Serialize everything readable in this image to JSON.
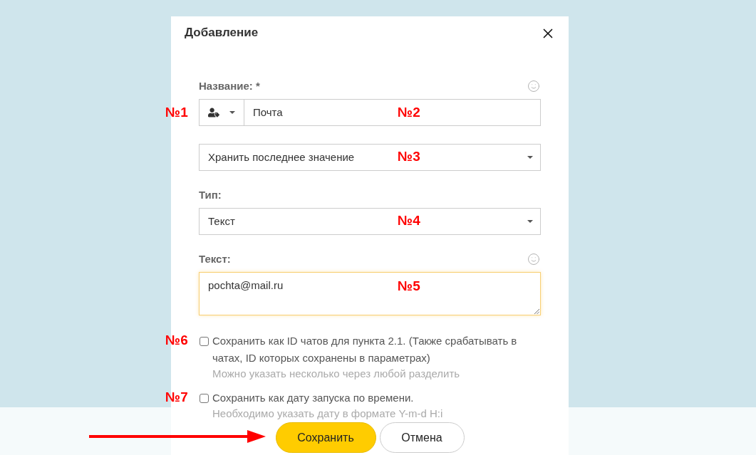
{
  "dialog": {
    "title": "Добавление"
  },
  "fields": [
    {
      "kind": "input_group",
      "label": "Название: *",
      "emoji_button": true,
      "value": "Почта",
      "focused": false,
      "addon_marker": "№1",
      "marker": "№2"
    },
    {
      "kind": "select",
      "value": "Хранить последнее значение",
      "focused": false,
      "marker": "№3"
    },
    {
      "kind": "select",
      "label": "Тип:",
      "value": "Текст",
      "focused": false,
      "marker": "№4"
    },
    {
      "kind": "textarea",
      "label": "Текст:",
      "emoji_button": true,
      "value": "pochta@mail.ru",
      "focused": true,
      "marker": "№5"
    }
  ],
  "options": [
    {
      "label": "Сохранить как ID чатов для пункта 2.1. (Также срабатывать в чатах, ID которых сохранены в параметрах)",
      "checked": false,
      "hint": "Можно указать несколько через любой разделить",
      "marker": "№6"
    },
    {
      "label": "Сохранить как дату запуска по времени.",
      "checked": false,
      "hint": "Необходимо указать дату в формате Y-m-d H:i",
      "marker": "№7"
    }
  ],
  "buttons": [
    {
      "kind": "primary",
      "label": "Сохранить"
    },
    {
      "kind": "secondary",
      "label": "Отмена"
    }
  ]
}
